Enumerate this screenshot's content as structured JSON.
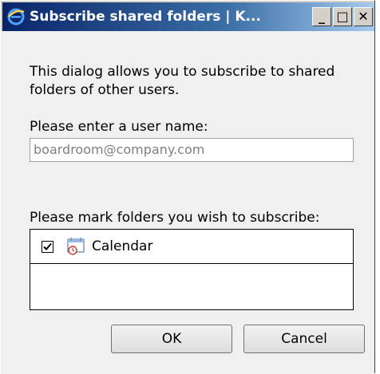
{
  "window": {
    "title": "Subscribe shared folders | K..."
  },
  "titlebar_buttons": {
    "minimize": "_",
    "maximize": "□",
    "close": "✕"
  },
  "dialog": {
    "description": "This dialog allows you to subscribe to shared folders of other users.",
    "username_label": "Please enter a user name:",
    "username_placeholder": "boardroom@company.com",
    "folders_label": "Please mark folders you wish to subscribe:",
    "folders": [
      {
        "name": "Calendar",
        "checked": true,
        "icon": "calendar-icon"
      }
    ]
  },
  "buttons": {
    "ok_label": "OK",
    "cancel_label": "Cancel"
  },
  "colors": {
    "titlebar_start": "#0a246a",
    "titlebar_end": "#a6caf0",
    "dialog_bg": "#f0f0f0"
  }
}
